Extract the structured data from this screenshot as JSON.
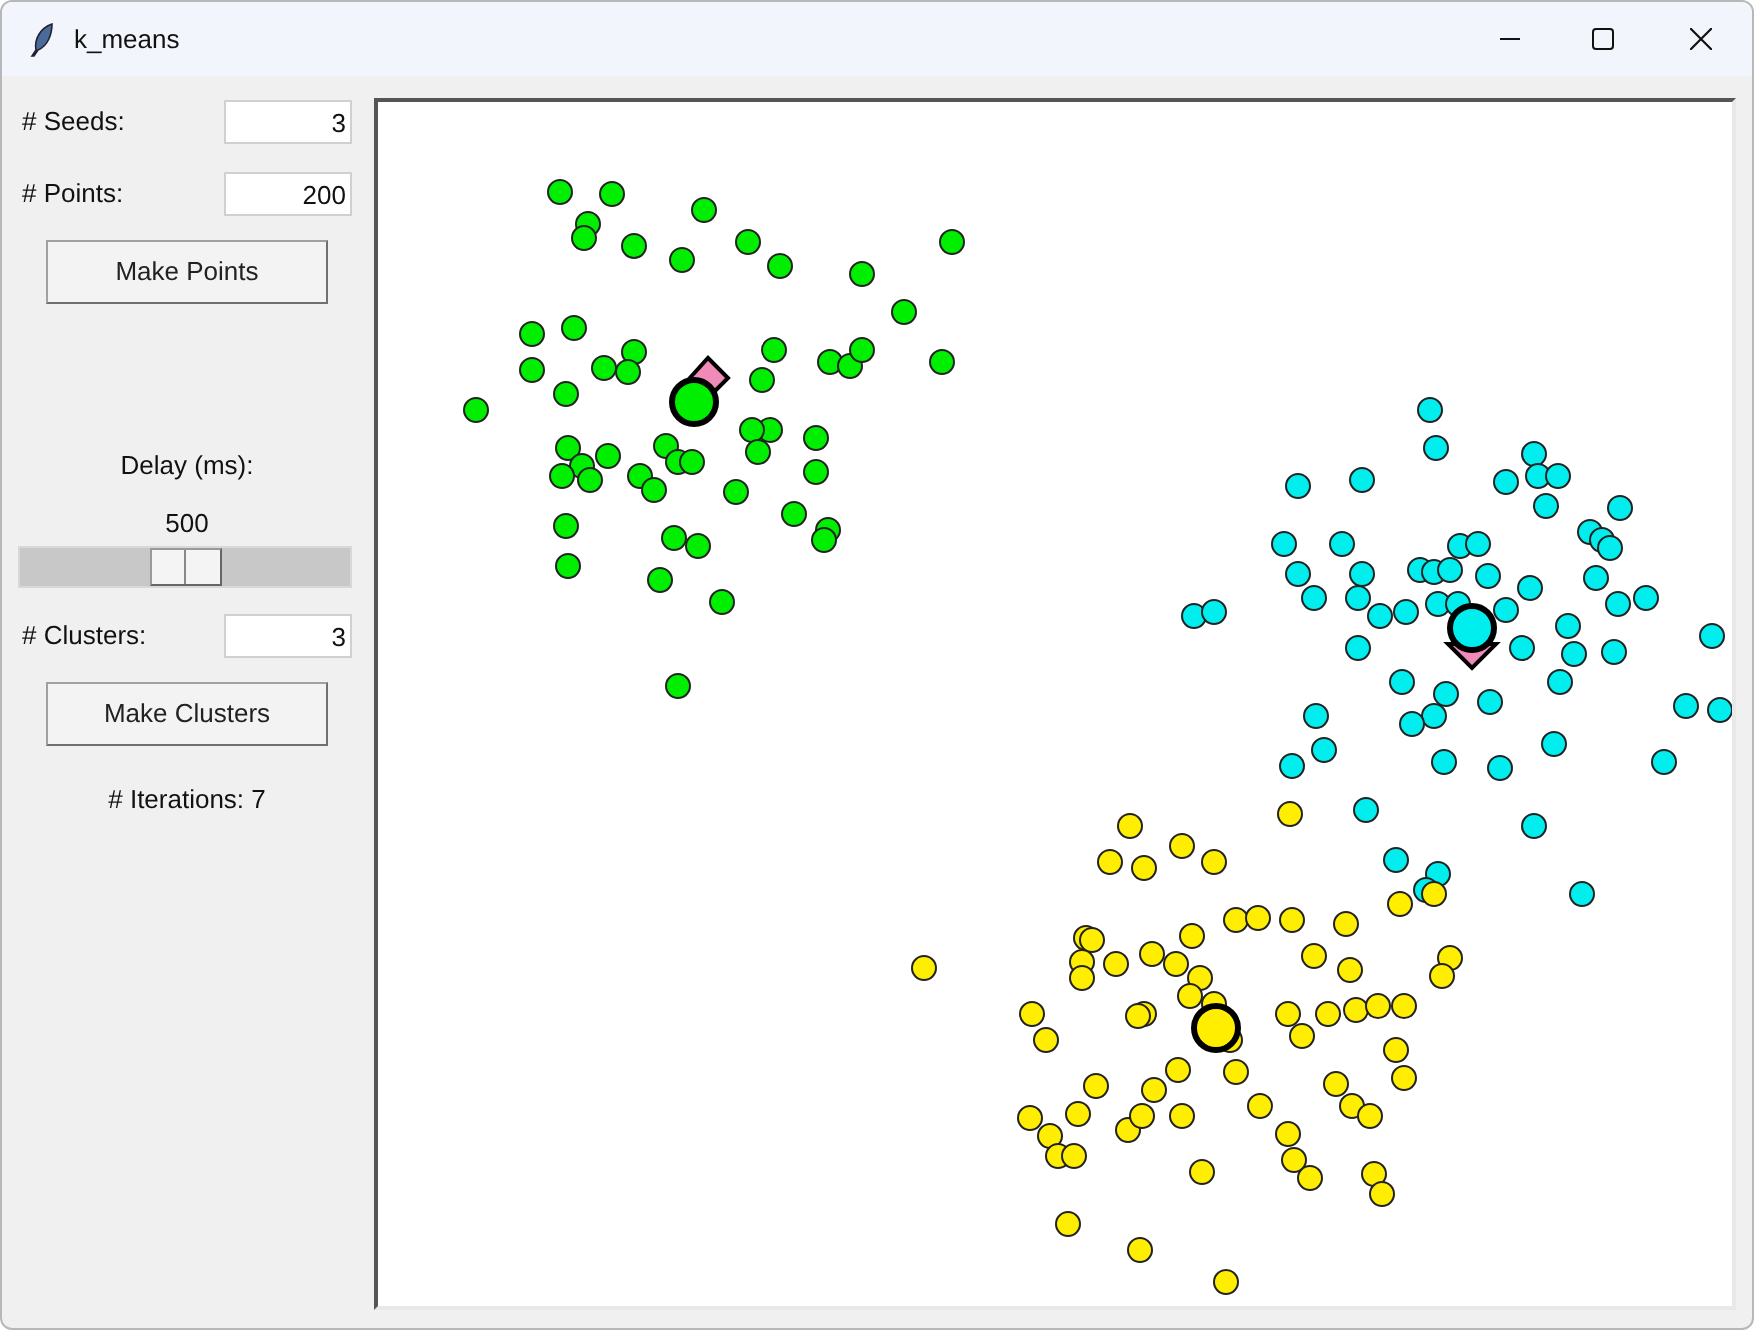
{
  "window": {
    "title": "k_means"
  },
  "seeds_field": {
    "label": "# Seeds:",
    "value": "3"
  },
  "points_field": {
    "label": "# Points:",
    "value": "200"
  },
  "make_points_button": {
    "label": "Make Points"
  },
  "delay": {
    "label": "Delay (ms):",
    "reading": "500",
    "level": 0.5
  },
  "clusters_field": {
    "label": "# Clusters:",
    "value": "3"
  },
  "make_clusters_button": {
    "label": "Make Clusters"
  },
  "iterations": {
    "label": "# Iterations: 7"
  }
}
